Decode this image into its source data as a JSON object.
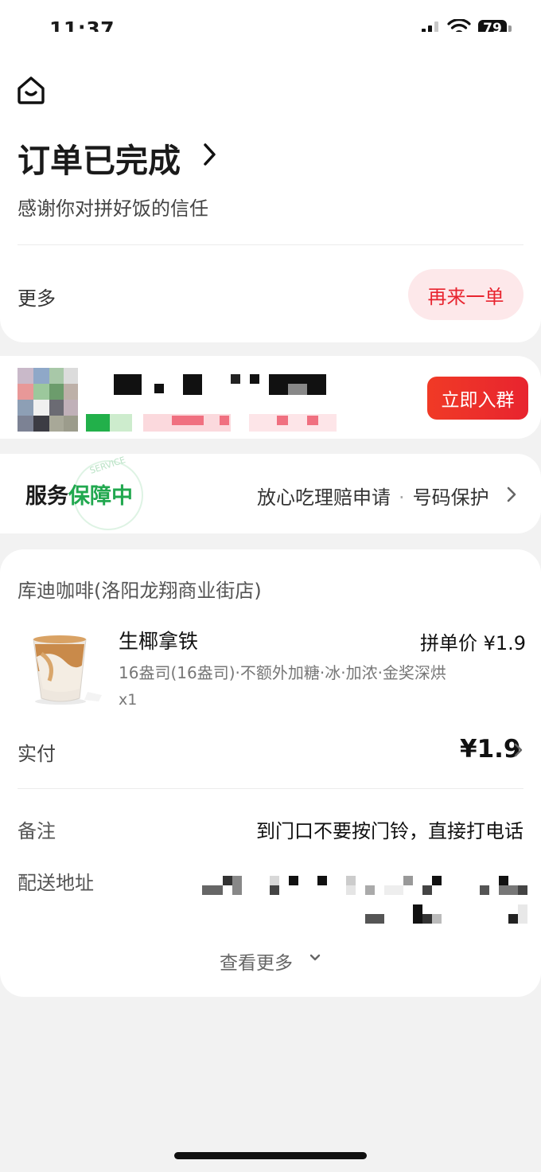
{
  "status_bar": {
    "time": "11:37",
    "battery": "79"
  },
  "header": {
    "title": "订单已完成",
    "subtitle": "感谢你对拼好饭的信任",
    "more_label": "更多",
    "reorder_label": "再来一单"
  },
  "group_promo": {
    "join_label": "立即入群"
  },
  "service": {
    "title_plain": "服务",
    "title_highlight": "保障中",
    "badge_text": "SERVICE",
    "claim_link": "放心吃理赔申请",
    "separator": "·",
    "number_protect": "号码保护"
  },
  "order": {
    "shop_name": "库迪咖啡(洛阳龙翔商业街店)",
    "items": [
      {
        "name": "生椰拿铁",
        "price": "拼单价 ¥1.9",
        "spec": "16盎司(16盎司)·不额外加糖·冰·加浓·金奖深烘",
        "qty": "x1"
      }
    ],
    "paid_label": "实付",
    "paid_value": "¥1.9",
    "note_label": "备注",
    "note_value": "到门口不要按门铃，直接打电话",
    "address_label": "配送地址",
    "see_more": "查看更多"
  },
  "colors": {
    "accent_red": "#e8242f",
    "service_green": "#21a84f",
    "reorder_bg": "#fde8ea"
  }
}
